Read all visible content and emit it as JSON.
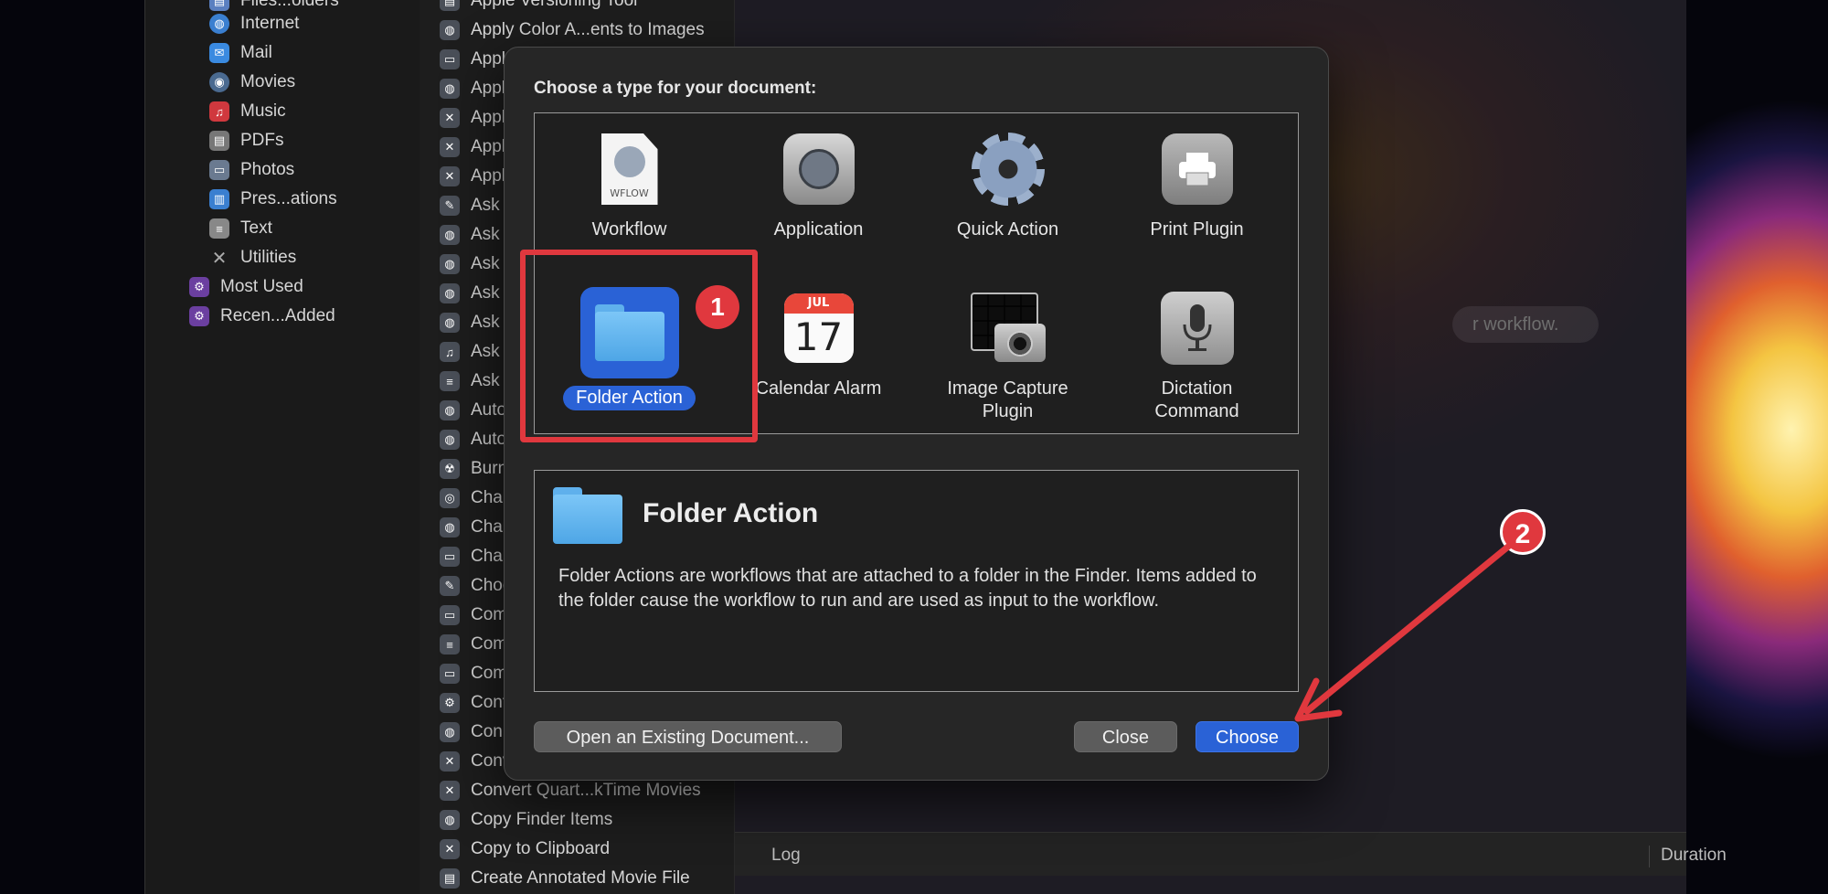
{
  "library": {
    "items": [
      {
        "label": "Files...olders",
        "icon": "folder-icon"
      },
      {
        "label": "Internet",
        "icon": "globe-icon"
      },
      {
        "label": "Mail",
        "icon": "mail-icon"
      },
      {
        "label": "Movies",
        "icon": "movie-icon"
      },
      {
        "label": "Music",
        "icon": "music-icon"
      },
      {
        "label": "PDFs",
        "icon": "pdf-icon"
      },
      {
        "label": "Photos",
        "icon": "photo-icon"
      },
      {
        "label": "Pres...ations",
        "icon": "presentation-icon"
      },
      {
        "label": "Text",
        "icon": "text-icon"
      },
      {
        "label": "Utilities",
        "icon": "tools-icon"
      }
    ],
    "smart_groups": [
      {
        "label": "Most Used",
        "icon": "smart-folder-icon"
      },
      {
        "label": "Recen...Added",
        "icon": "smart-folder-icon"
      }
    ]
  },
  "actions": {
    "items": [
      "Apple Versioning Tool",
      "Apply Color A...ents to Images",
      "Apply",
      "Apply",
      "Apply",
      "Apply",
      "Apply",
      "Ask fo",
      "Ask fo",
      "Ask fo",
      "Ask fo",
      "Ask F",
      "Ask fo",
      "Ask fo",
      "Auto",
      "Auto",
      "Burn",
      "Chan",
      "Chan",
      "Chan",
      "Choo",
      "Comb",
      "Comb",
      "Comp",
      "Confi",
      "Conn",
      "Conv",
      "Convert Quart...kTime Movies",
      "Copy Finder Items",
      "Copy to Clipboard",
      "Create Annotated Movie File"
    ]
  },
  "workflow": {
    "hint": "r workflow.",
    "log_label": "Log",
    "duration_label": "Duration"
  },
  "dialog": {
    "title": "Choose a type for your document:",
    "types": [
      {
        "label": "Workflow",
        "icon": "workflow-document-icon"
      },
      {
        "label": "Application",
        "icon": "automator-app-icon"
      },
      {
        "label": "Quick Action",
        "icon": "gear-icon"
      },
      {
        "label": "Print Plugin",
        "icon": "printer-icon"
      },
      {
        "label": "Folder Action",
        "icon": "folder-icon"
      },
      {
        "label": "Calendar Alarm",
        "icon": "calendar-icon"
      },
      {
        "label": "Image Capture\nPlugin",
        "icon": "camera-icon"
      },
      {
        "label": "Dictation\nCommand",
        "icon": "microphone-icon"
      }
    ],
    "selected": "Folder Action",
    "wflow_ext": "WFLOW",
    "calendar_month": "JUL",
    "calendar_day": "17",
    "description": {
      "title": "Folder Action",
      "text": "Folder Actions are workflows that are attached to a folder in the Finder. Items added to the folder cause the workflow to run and are used as input to the workflow."
    },
    "buttons": {
      "open_existing": "Open an Existing Document...",
      "close": "Close",
      "choose": "Choose"
    }
  },
  "annotations": {
    "step1": "1",
    "step2": "2",
    "color": "#e0383e"
  },
  "colors": {
    "accent": "#2a62d6",
    "dialog_bg": "#262626"
  }
}
